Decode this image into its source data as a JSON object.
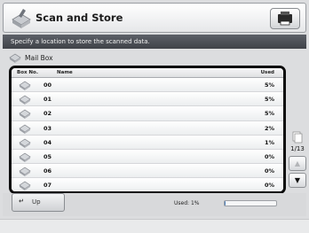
{
  "header": {
    "title": "Scan and Store"
  },
  "instruction": "Specify a location to store the scanned data.",
  "location": {
    "label": "Mail Box"
  },
  "list": {
    "columns": {
      "box_no": "Box No.",
      "name": "Name",
      "used": "Used"
    },
    "rows": [
      {
        "num": "00",
        "used": "5%"
      },
      {
        "num": "01",
        "used": "5%"
      },
      {
        "num": "02",
        "used": "5%"
      },
      {
        "num": "03",
        "used": "2%"
      },
      {
        "num": "04",
        "used": "1%"
      },
      {
        "num": "05",
        "used": "0%"
      },
      {
        "num": "06",
        "used": "0%"
      },
      {
        "num": "07",
        "used": "0%"
      }
    ]
  },
  "pagination": {
    "page": "1/13",
    "up_icon": "up-arrow-icon",
    "down_icon": "down-arrow-icon"
  },
  "footer": {
    "up_label": "Up",
    "used_label": "Used:",
    "used_value": "1%",
    "used_fraction": 0.01
  },
  "colors": {
    "accent": "#4a7db8",
    "border": "#0d0d0d"
  }
}
